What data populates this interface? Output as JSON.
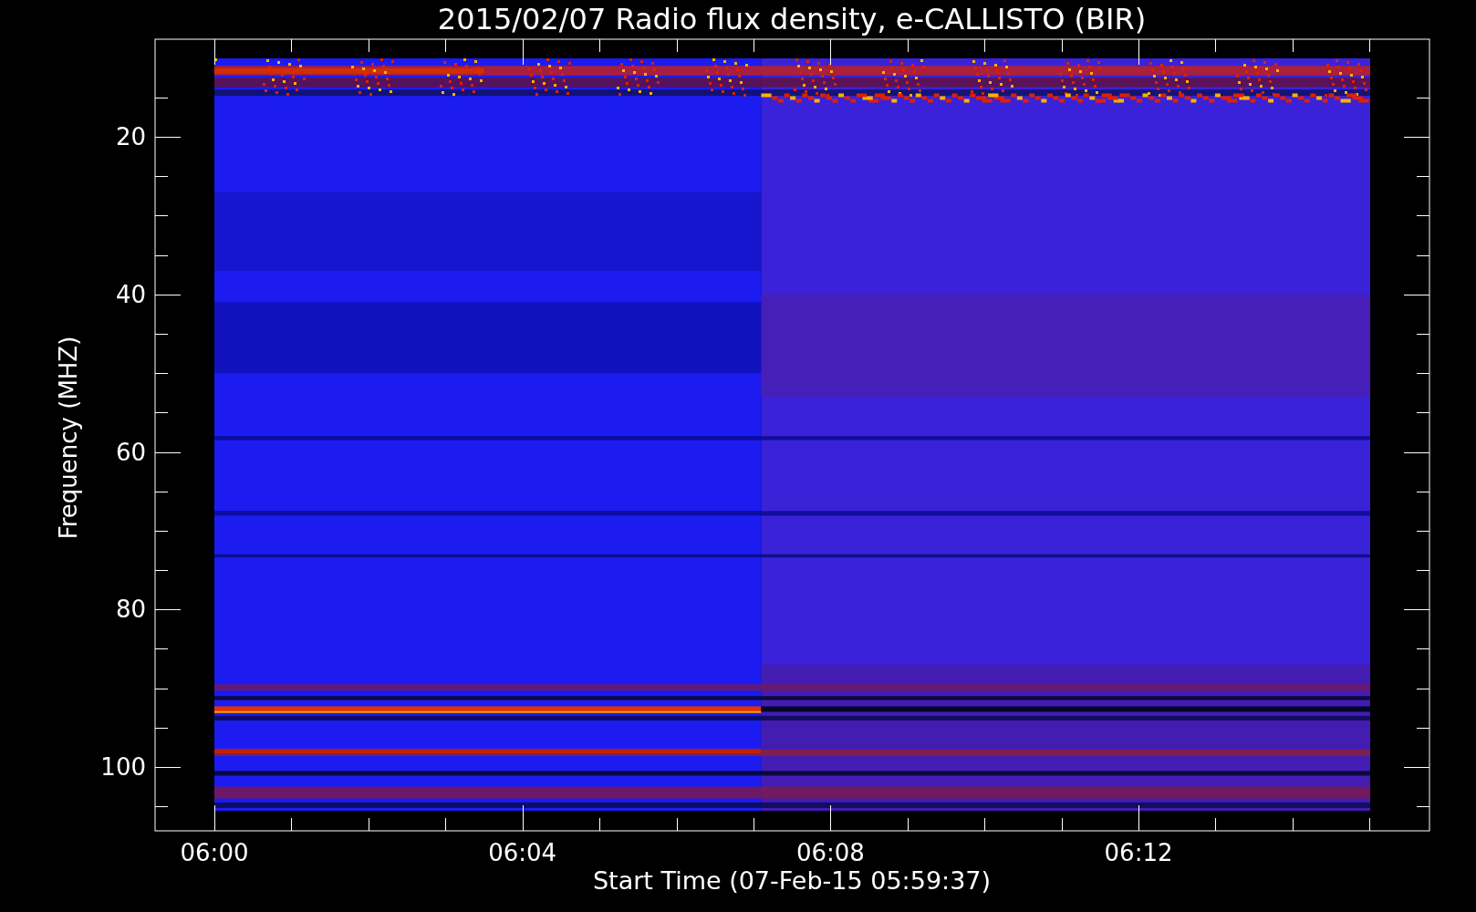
{
  "plot": {
    "title": "2015/02/07  Radio flux density, e-CALLISTO (BIR)",
    "y_axis": {
      "label": "Frequency (MHZ)",
      "tick_labels": [
        "20",
        "40",
        "60",
        "80",
        "100"
      ]
    },
    "x_axis": {
      "label": "Start Time (07-Feb-15 05:59:37)",
      "tick_labels": [
        "06:00",
        "06:04",
        "06:08",
        "06:12"
      ]
    }
  }
}
